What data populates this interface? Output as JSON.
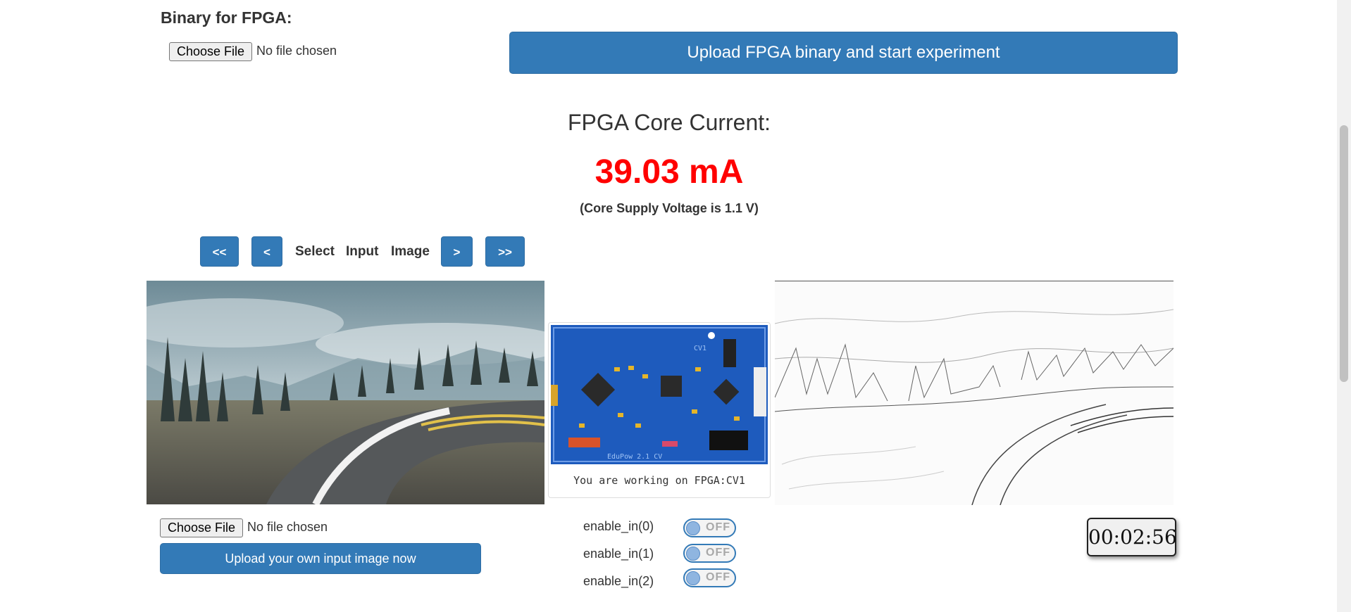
{
  "binary_section": {
    "title": "Binary for FPGA:",
    "choose_file_label": "Choose File",
    "file_status": "No file chosen",
    "upload_button_label": "Upload FPGA binary and start experiment"
  },
  "current": {
    "heading": "FPGA Core Current:",
    "value": "39.03 mA",
    "supply_note": "(Core Supply Voltage is 1.1 V)",
    "value_color": "#ff0000"
  },
  "image_nav": {
    "first_label": "<<",
    "prev_label": "<",
    "words": [
      "Select",
      "Input",
      "Image"
    ],
    "next_label": ">",
    "last_label": ">>"
  },
  "board": {
    "caption": "You are working on FPGA:CV1",
    "silkscreen_top": "CV1",
    "silkscreen_bottom": "EduPow 2.1 CV"
  },
  "own_image": {
    "choose_file_label": "Choose File",
    "file_status": "No file chosen",
    "upload_button_label": "Upload your own input image now"
  },
  "switches": [
    {
      "label": "enable_in(0)",
      "state": "OFF"
    },
    {
      "label": "enable_in(1)",
      "state": "OFF"
    },
    {
      "label": "enable_in(2)",
      "state": "OFF"
    }
  ],
  "timer": {
    "value": "00:02:56"
  },
  "colors": {
    "accent": "#337ab7",
    "danger": "#ff0000"
  },
  "icons": {
    "input_image": "road-photo",
    "board_image": "fpga-board-photo",
    "output_image": "edge-detected-road"
  }
}
